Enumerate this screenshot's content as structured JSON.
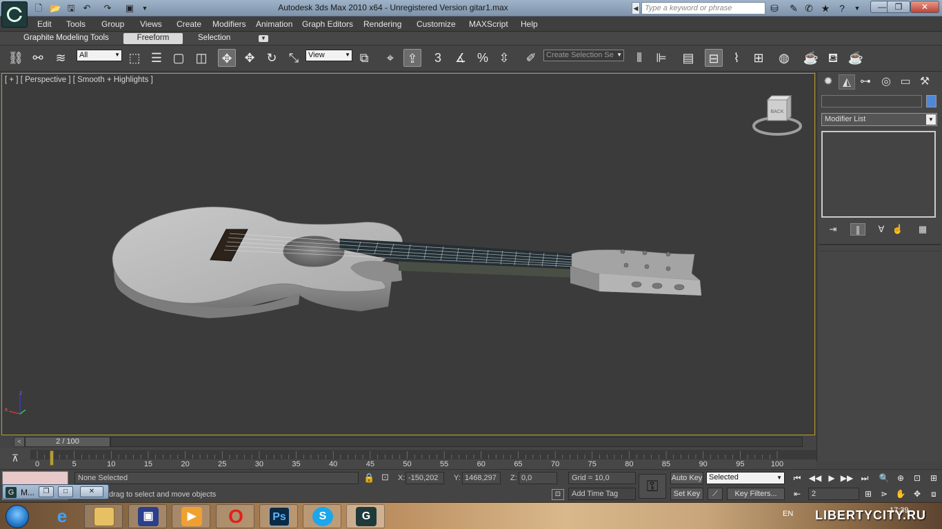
{
  "window": {
    "title": "Autodesk 3ds Max 2010 x64 - Unregistered Version      gitar1.max",
    "search_placeholder": "Type a keyword or phrase",
    "minimize": "—",
    "restore": "❐",
    "close": "✕"
  },
  "menu": [
    "Edit",
    "Tools",
    "Group",
    "Views",
    "Create",
    "Modifiers",
    "Animation",
    "Graph Editors",
    "Rendering",
    "Customize",
    "MAXScript",
    "Help"
  ],
  "ribbon": {
    "title": "Graphite Modeling Tools",
    "tabs": [
      "Freeform",
      "Selection"
    ]
  },
  "toolbar": {
    "selection_filter": "All",
    "reference_coord": "View",
    "named_selection_placeholder": "Create Selection Se",
    "snap_labels": {
      "snap3": "3",
      "angle": "",
      "percent": "%"
    }
  },
  "viewport": {
    "label": "[ + ] [ Perspective ] [ Smooth + Highlights ]",
    "viewcube_face": "BACK",
    "axes": {
      "x": "x",
      "y": "y",
      "z": "z"
    }
  },
  "command_panel": {
    "object_color": "#4f87d9",
    "modifier_list": "Modifier List"
  },
  "time_slider": {
    "frame_display": "2 / 100",
    "current_frame": 2,
    "total_frames": 100,
    "prev": "<",
    "next": ">"
  },
  "trackbar": {
    "ticks": [
      "0",
      "5",
      "10",
      "15",
      "20",
      "25",
      "30",
      "35",
      "40",
      "45",
      "50",
      "55",
      "60",
      "65",
      "70",
      "75",
      "80",
      "85",
      "90",
      "95",
      "100"
    ]
  },
  "status": {
    "selection": "None Selected",
    "prompt": "drag to select and move objects",
    "x_label": "X:",
    "x_value": "-150,202",
    "y_label": "Y:",
    "y_value": "1468,297",
    "z_label": "Z:",
    "z_value": "0,0",
    "grid": "Grid = 10,0",
    "add_time_tag": "Add Time Tag",
    "auto_key": "Auto Key",
    "set_key": "Set Key",
    "key_filters": "Key Filters...",
    "selected_dropdown": "Selected",
    "frame_field": "2"
  },
  "mini_window": {
    "title": "M..."
  },
  "taskbar": {
    "language": "EN",
    "clock": "17:39",
    "watermark": "LIBERTYCITY.RU",
    "apps": [
      "ie",
      "explorer",
      "save",
      "media",
      "opera",
      "photoshop",
      "skype",
      "3dsmax"
    ]
  }
}
